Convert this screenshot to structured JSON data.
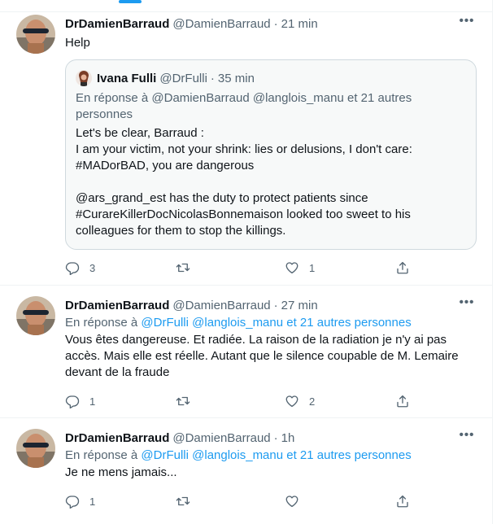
{
  "tweets": [
    {
      "name": "DrDamienBarraud",
      "handle": "@DamienBarraud",
      "dot": "·",
      "time": "21 min",
      "more": "•••",
      "text": "Help",
      "quote": {
        "name": "Ivana Fulli",
        "handle": "@DrFulli",
        "dot": "·",
        "time": "35 min",
        "reply_prefix": "En réponse à",
        "reply_to": "@DamienBarraud @langlois_manu",
        "reply_suffix": "et 21 autres personnes",
        "lines": [
          "Let's be clear, Barraud :",
          "I am your victim, not your shrink: lies or delusions, I don't care:",
          "#MADorBAD, you are dangerous",
          "",
          "@ars_grand_est has the duty to protect patients since",
          "#CurareKillerDocNicolasBonnemaison looked too sweet to his",
          "colleagues for them to stop the killings."
        ]
      },
      "replies": "3",
      "retweets": "",
      "likes": "1"
    },
    {
      "name": "DrDamienBarraud",
      "handle": "@DamienBarraud",
      "dot": "·",
      "time": "27 min",
      "more": "•••",
      "reply_prefix": "En réponse à",
      "reply_to": "@DrFulli @langlois_manu  et 21 autres personnes",
      "lines": [
        "Vous êtes dangereuse. Et radiée. La raison de la radiation je n'y ai pas",
        "accès. Mais elle est réelle. Autant que le silence coupable de M. Lemaire",
        "devant de la fraude"
      ],
      "replies": "1",
      "retweets": "",
      "likes": "2"
    },
    {
      "name": "DrDamienBarraud",
      "handle": "@DamienBarraud",
      "dot": "·",
      "time": "1h",
      "more": "•••",
      "reply_prefix": "En réponse à",
      "reply_to": "@DrFulli @langlois_manu  et 21 autres personnes",
      "lines": [
        "Je ne mens jamais..."
      ],
      "replies": "1",
      "retweets": "",
      "likes": ""
    }
  ],
  "colors": {
    "accent": "#1d9bf0",
    "secondary_text": "#536471",
    "primary_text": "#0f1419"
  },
  "icons": [
    "reply-icon",
    "retweet-icon",
    "like-icon",
    "share-icon",
    "more-icon"
  ]
}
